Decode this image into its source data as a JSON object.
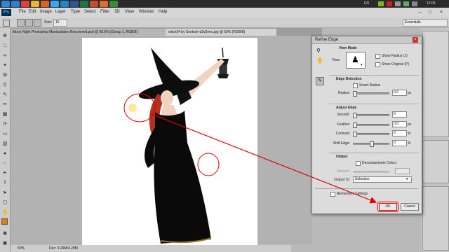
{
  "taskbar": {
    "lang": "EN",
    "clock": "12:05",
    "apps": [
      {
        "name": "windows-icon",
        "color": "#2b88d8"
      },
      {
        "name": "ie-icon",
        "color": "#2d7fd1"
      },
      {
        "name": "chrome-icon",
        "color": "#e0403a"
      },
      {
        "name": "folder-icon",
        "color": "#e8b43a"
      },
      {
        "name": "media-icon",
        "color": "#e06020"
      },
      {
        "name": "ps-icon",
        "color": "#31a8ff"
      },
      {
        "name": "app-icon",
        "color": "#1e88c8"
      },
      {
        "name": "word-icon",
        "color": "#2b579a"
      },
      {
        "name": "excel-icon",
        "color": "#217346"
      },
      {
        "name": "app2-icon",
        "color": "#c84a2b"
      },
      {
        "name": "app3-icon",
        "color": "#e06b2b"
      },
      {
        "name": "app4-icon",
        "color": "#3b8a3b"
      }
    ]
  },
  "menubar": {
    "logo": "Ps",
    "items": [
      "File",
      "Edit",
      "Image",
      "Layer",
      "Type",
      "Select",
      "Filter",
      "3D",
      "View",
      "Window",
      "Help"
    ]
  },
  "options": {
    "size_label": "Size:",
    "size_value": "15",
    "workspace": "Essentials"
  },
  "tabs": [
    "Moon Night Photoshop Manipulation Recovered.psd @ 66.6% (Group 1, RGB/8)",
    "witch34 by Sestock-d3y5eec.jpg @ 50% (RGB/8)"
  ],
  "status": {
    "zoom": "50%",
    "doc": "Doc: 4.29M/4.29M"
  },
  "dialog": {
    "title": "Refine Edge",
    "view_mode": {
      "heading": "View Mode",
      "view_label": "View:",
      "show_radius": "Show Radius (J)",
      "show_original": "Show Original (P)"
    },
    "edge_detection": {
      "heading": "Edge Detection",
      "smart_radius": "Smart Radius",
      "radius_label": "Radius:",
      "radius_value": "0.0",
      "radius_unit": "px"
    },
    "adjust_edge": {
      "heading": "Adjust Edge",
      "smooth_label": "Smooth:",
      "smooth_value": "0",
      "feather_label": "Feather:",
      "feather_value": "0.0",
      "feather_unit": "px",
      "contrast_label": "Contrast:",
      "contrast_value": "0",
      "contrast_unit": "%",
      "shift_label": "Shift Edge:",
      "shift_value": "0",
      "shift_unit": "%"
    },
    "output": {
      "heading": "Output",
      "decontaminate": "Decontaminate Colors",
      "amount_label": "Amount:",
      "output_to_label": "Output To:",
      "output_to_value": "Selection"
    },
    "remember": "Remember Settings",
    "ok": "OK",
    "cancel": "Cancel"
  },
  "colors": {
    "annotation": "#e00000"
  }
}
